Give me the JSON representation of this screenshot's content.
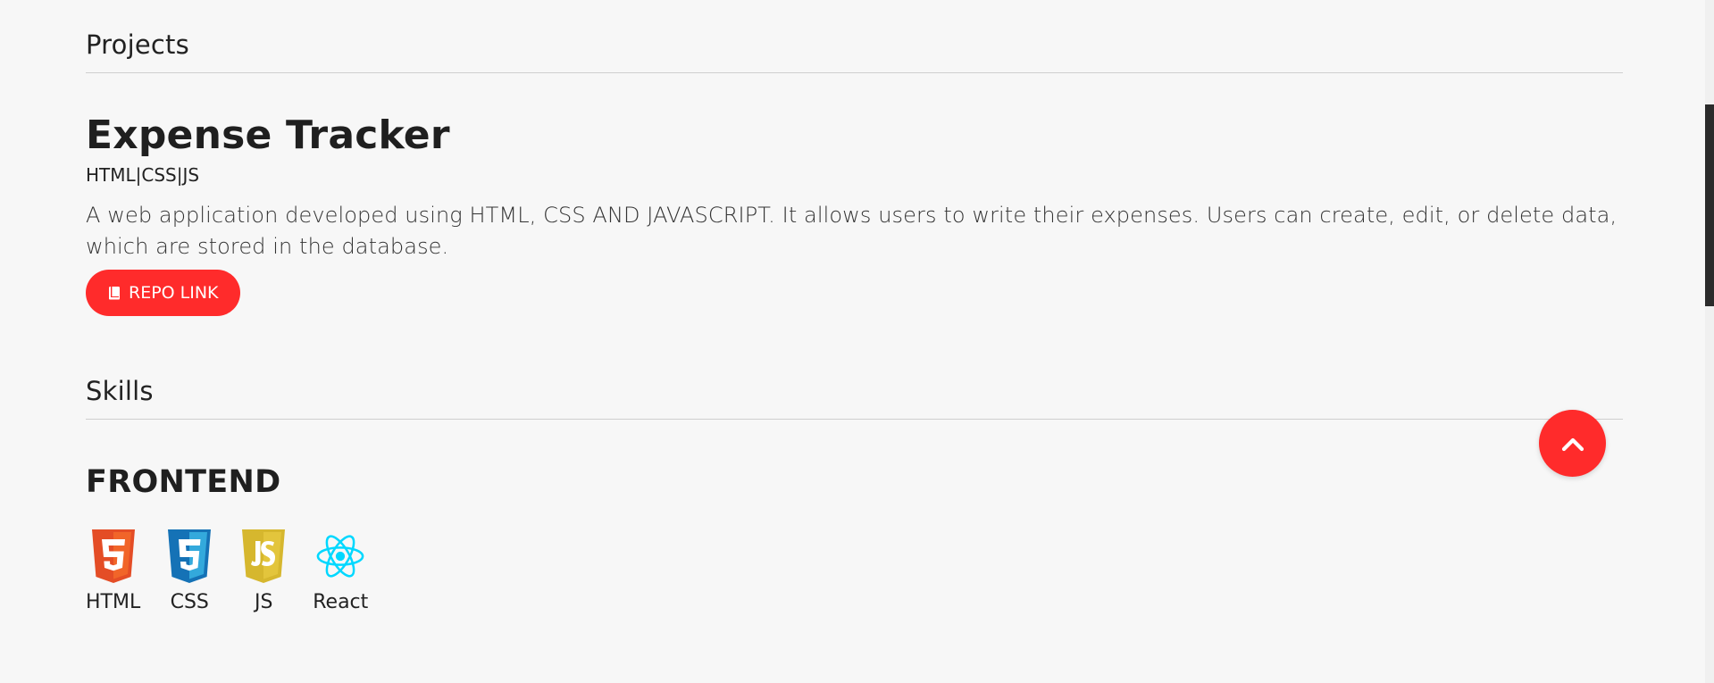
{
  "projects": {
    "heading": "Projects",
    "items": [
      {
        "title": "Expense Tracker",
        "tech": "HTML|CSS|JS",
        "description": "A web application developed using HTML, CSS AND JAVASCRIPT. It allows users to write their expenses. Users can create, edit, or delete data, which are stored in the database.",
        "repo_label": "REPO LINK",
        "repo_icon": "book-icon"
      }
    ]
  },
  "skills": {
    "heading": "Skills",
    "categories": [
      {
        "name": "FRONTEND",
        "items": [
          {
            "label": "HTML",
            "icon": "html5-icon",
            "color": "#e44d26"
          },
          {
            "label": "CSS",
            "icon": "css3-icon",
            "color": "#1572b6"
          },
          {
            "label": "JS",
            "icon": "javascript-icon",
            "color": "#d6b72e"
          },
          {
            "label": "React",
            "icon": "react-icon",
            "color": "#00d8ff"
          }
        ]
      }
    ]
  },
  "scroll_top_button": {
    "icon": "chevron-up-icon"
  },
  "colors": {
    "accent": "#ff2b2b",
    "background": "#f7f7f7",
    "text": "#1f1f1f"
  }
}
